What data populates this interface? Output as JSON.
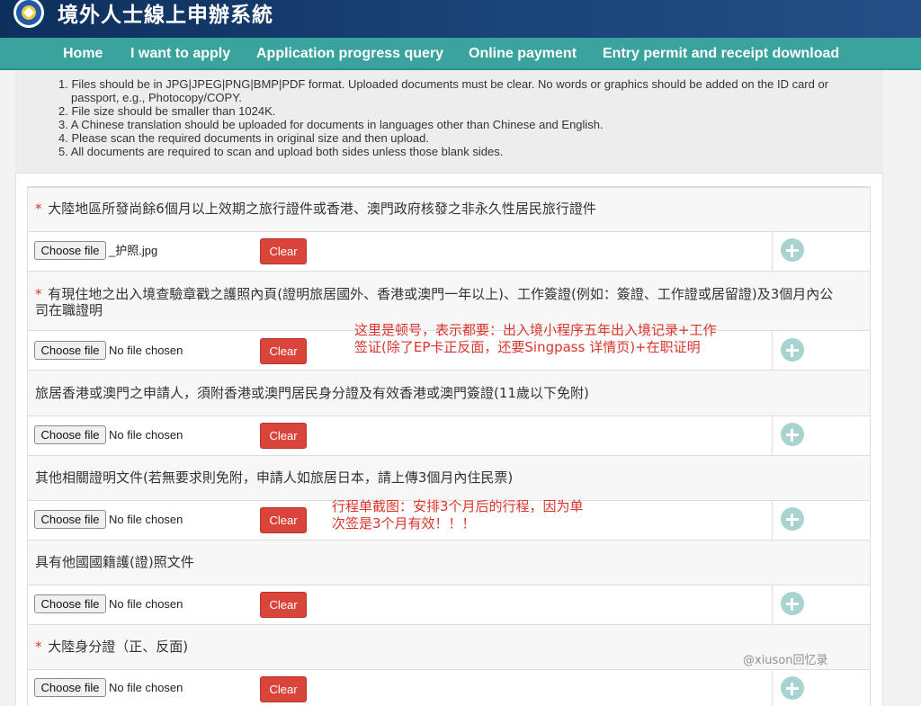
{
  "header": {
    "site_title": "境外人士線上申辦系統",
    "logo_icon": "emblem-icon"
  },
  "nav": [
    {
      "label": "Home"
    },
    {
      "label": "I want to apply"
    },
    {
      "label": "Application progress query"
    },
    {
      "label": "Online payment"
    },
    {
      "label": "Entry permit and receipt download"
    }
  ],
  "notes": [
    "1. Files should be in JPG|JPEG|PNG|BMP|PDF format. Uploaded documents must be clear. No words or graphics should be added on the ID card or",
    "passport, e.g., Photocopy/COPY.",
    "2. File size should be smaller than 1024K.",
    "3. A Chinese translation should be uploaded for documents in languages other than Chinese and English.",
    "4. Please scan the required documents in original size and then upload.",
    "5. All documents are required to scan and upload both sides unless those blank sides."
  ],
  "sections": [
    {
      "required": true,
      "title_line1": "大陸地區所發尚餘6個月以上效期之旅行證件或香港、澳門政府核發之非永久性居民旅行證件",
      "title_line2": "",
      "file_status": "_护照.jpg"
    },
    {
      "required": true,
      "title_line1": "有現住地之出入境查驗章戳之護照內頁(證明旅居國外、香港或澳門一年以上)、工作簽證(例如：簽證、工作證或居留證)及3個月內公",
      "title_line2": "司在職證明",
      "file_status": "No file chosen"
    },
    {
      "required": false,
      "title_line1": "旅居香港或澳門之申請人，須附香港或澳門居民身分證及有效香港或澳門簽證(11歲以下免附)",
      "title_line2": "",
      "file_status": "No file chosen"
    },
    {
      "required": false,
      "title_line1": "其他相關證明文件(若無要求則免附，申請人如旅居日本，請上傳3個月內住民票)",
      "title_line2": "",
      "file_status": "No file chosen"
    },
    {
      "required": false,
      "title_line1": "具有他國國籍護(證)照文件",
      "title_line2": "",
      "file_status": "No file chosen"
    },
    {
      "required": true,
      "title_line1": "大陸身分證（正、反面)",
      "title_line2": "",
      "file_status": "No file chosen"
    }
  ],
  "controls": {
    "choose_label": "Choose file",
    "clear_label": "Clear",
    "required_mark": "*",
    "add_icon": "plus-circle-icon"
  },
  "annotations": {
    "note1_line1": "这里是顿号，表示都要：出入境小程序五年出入境记录+工作",
    "note1_line2": "签证(除了EP卡正反面，还要Singpass 详情页)+在职证明",
    "note2_line1": "行程单截图：安排3个月后的行程，因为单",
    "note2_line2": "次签是3个月有效！！！"
  },
  "watermark": "@xiuson回忆录"
}
